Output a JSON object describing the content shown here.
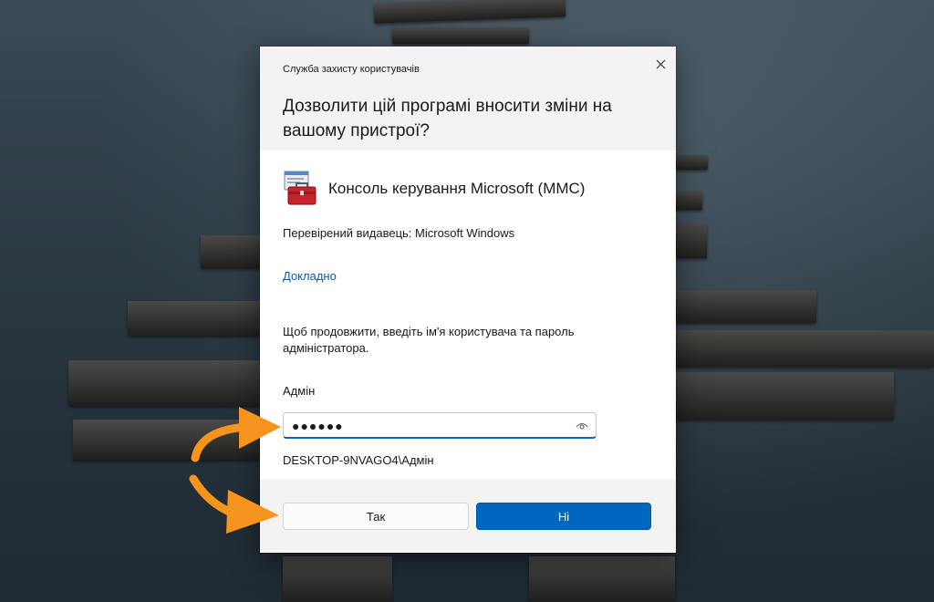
{
  "dialog": {
    "title": "Служба захисту користувачів",
    "question": "Дозволити цій програмі вносити зміни на вашому пристрої?",
    "app_name": "Консоль керування Microsoft (MMC)",
    "publisher": "Перевірений видавець: Microsoft Windows",
    "details_link": "Докладно",
    "instructions": "Щоб продовжити, введіть ім'я користувача та пароль адміністратора.",
    "username": "Адмін",
    "password_value": "●●●●●●",
    "domain_user": "DESKTOP-9NVAGO4\\Адмін",
    "yes_label": "Так",
    "no_label": "Ні"
  },
  "colors": {
    "accent": "#0067c0",
    "link": "#0b5cad",
    "annotation_arrow": "#f7941d"
  },
  "icons": {
    "app": "toolbox-icon",
    "close": "close-icon",
    "reveal": "eye-icon"
  }
}
